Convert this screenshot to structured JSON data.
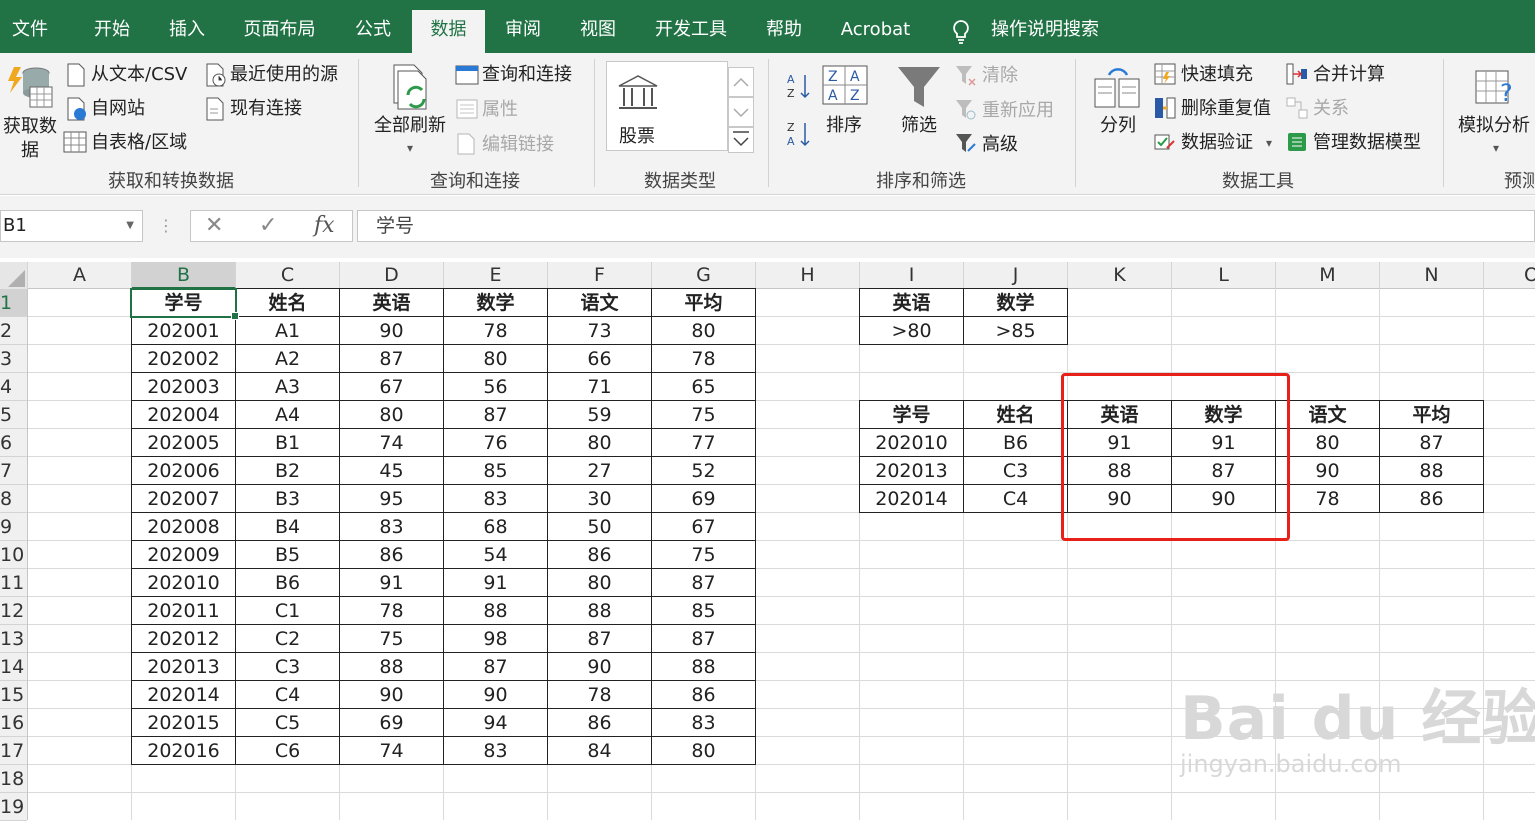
{
  "ribbon_tabs": [
    "文件",
    "开始",
    "插入",
    "页面布局",
    "公式",
    "数据",
    "审阅",
    "视图",
    "开发工具",
    "帮助",
    "Acrobat"
  ],
  "active_tab": "数据",
  "tell_me": "操作说明搜索",
  "groups": {
    "get_data": {
      "label": "获取和转换数据",
      "get_data_btn": "获取数\n据",
      "from_text": "从文本/CSV",
      "from_web": "自网站",
      "from_table": "自表格/区域",
      "recent": "最近使用的源",
      "existing": "现有连接"
    },
    "queries": {
      "label": "查询和连接",
      "refresh_all": "全部刷新",
      "queries_conn": "查询和连接",
      "properties": "属性",
      "edit_links": "编辑链接"
    },
    "data_types": {
      "label": "数据类型",
      "stocks": "股票"
    },
    "sort_filter": {
      "label": "排序和筛选",
      "sort": "排序",
      "filter": "筛选",
      "clear": "清除",
      "reapply": "重新应用",
      "advanced": "高级"
    },
    "data_tools": {
      "label": "数据工具",
      "text_to_cols": "分列",
      "flash_fill": "快速填充",
      "remove_dup": "删除重复值",
      "validation": "数据验证",
      "consolidate": "合并计算",
      "relations": "关系",
      "manage_model": "管理数据模型"
    },
    "forecast": {
      "label": "预测",
      "what_if": "模拟分析"
    }
  },
  "name_box": "B1",
  "formula": "学号",
  "column_headers": [
    "A",
    "B",
    "C",
    "D",
    "E",
    "F",
    "G",
    "H",
    "I",
    "J",
    "K",
    "L",
    "M",
    "N",
    "O"
  ],
  "selected_column": "B",
  "row_headers": [
    "1",
    "2",
    "3",
    "4",
    "5",
    "6",
    "7",
    "8",
    "9",
    "10",
    "11",
    "12",
    "13",
    "14",
    "15",
    "16",
    "17",
    "18",
    "19"
  ],
  "selected_row": "1",
  "main_table": {
    "headers": [
      "学号",
      "姓名",
      "英语",
      "数学",
      "语文",
      "平均"
    ],
    "rows": [
      [
        "202001",
        "A1",
        "90",
        "78",
        "73",
        "80"
      ],
      [
        "202002",
        "A2",
        "87",
        "80",
        "66",
        "78"
      ],
      [
        "202003",
        "A3",
        "67",
        "56",
        "71",
        "65"
      ],
      [
        "202004",
        "A4",
        "80",
        "87",
        "59",
        "75"
      ],
      [
        "202005",
        "B1",
        "74",
        "76",
        "80",
        "77"
      ],
      [
        "202006",
        "B2",
        "45",
        "85",
        "27",
        "52"
      ],
      [
        "202007",
        "B3",
        "95",
        "83",
        "30",
        "69"
      ],
      [
        "202008",
        "B4",
        "83",
        "68",
        "50",
        "67"
      ],
      [
        "202009",
        "B5",
        "86",
        "54",
        "86",
        "75"
      ],
      [
        "202010",
        "B6",
        "91",
        "91",
        "80",
        "87"
      ],
      [
        "202011",
        "C1",
        "78",
        "88",
        "88",
        "85"
      ],
      [
        "202012",
        "C2",
        "75",
        "98",
        "87",
        "87"
      ],
      [
        "202013",
        "C3",
        "88",
        "87",
        "90",
        "88"
      ],
      [
        "202014",
        "C4",
        "90",
        "90",
        "78",
        "86"
      ],
      [
        "202015",
        "C5",
        "69",
        "94",
        "86",
        "83"
      ],
      [
        "202016",
        "C6",
        "74",
        "83",
        "84",
        "80"
      ]
    ]
  },
  "criteria_table": {
    "headers": [
      "英语",
      "数学"
    ],
    "row": [
      ">80",
      ">85"
    ]
  },
  "result_table": {
    "headers": [
      "学号",
      "姓名",
      "英语",
      "数学",
      "语文",
      "平均"
    ],
    "rows": [
      [
        "202010",
        "B6",
        "91",
        "91",
        "80",
        "87"
      ],
      [
        "202013",
        "C3",
        "88",
        "87",
        "90",
        "88"
      ],
      [
        "202014",
        "C4",
        "90",
        "90",
        "78",
        "86"
      ]
    ]
  },
  "watermark": {
    "logo": "Bai du 经验",
    "url": "jingyan.baidu.com"
  },
  "colors": {
    "accent": "#217346",
    "highlight": "#e8201a"
  }
}
